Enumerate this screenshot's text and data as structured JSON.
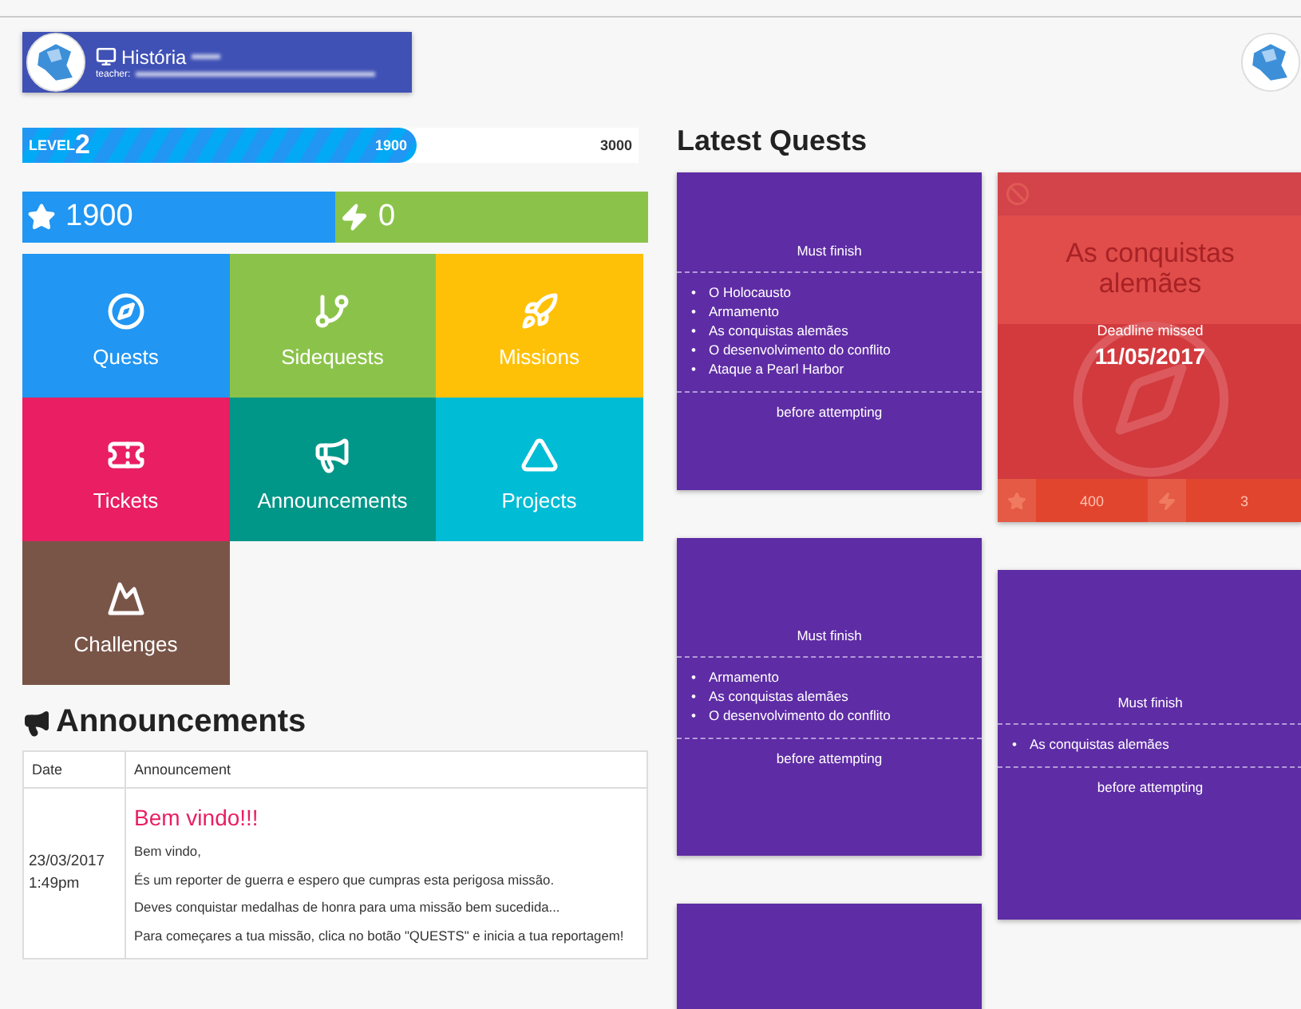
{
  "header": {
    "course_title": "História",
    "teacher_label": "teacher:"
  },
  "level_bar": {
    "label": "LEVEL",
    "number": "2",
    "current": "1900",
    "max": "3000",
    "level": 0.64
  },
  "stats": [
    {
      "kind": "xp",
      "value": "1900"
    },
    {
      "kind": "coins",
      "value": "0"
    }
  ],
  "menu_tiles": [
    {
      "label": "Quests",
      "color": "#2196f3"
    },
    {
      "label": "Sidequests",
      "color": "#8bc34a"
    },
    {
      "label": "Missions",
      "color": "#ffc107"
    },
    {
      "label": "Tickets",
      "color": "#e91e63"
    },
    {
      "label": "Announcements",
      "color": "#009688"
    },
    {
      "label": "Projects",
      "color": "#00bcd4"
    },
    {
      "label": "Challenges",
      "color": "#795548"
    }
  ],
  "announcements": {
    "heading": "Announcements",
    "columns": [
      "Date",
      "Announcement"
    ],
    "rows": [
      {
        "date": "23/03/2017",
        "time": "1:49pm",
        "title": "Bem vindo!!!",
        "paragraphs": [
          "Bem vindo,",
          "És um reporter de guerra e espero que cumpras esta perigosa missão.",
          "Deves conquistar medalhas de honra para uma missão bem sucedida...",
          "Para começares a tua missão, clica no botão \"QUESTS\" e inicia a tua reportagem!"
        ]
      }
    ]
  },
  "latest_quests": {
    "heading": "Latest Quests",
    "columns": [
      [
        {
          "kind": "locked",
          "header": "Must finish",
          "marker": "•",
          "items": [
            "O Holocausto",
            "Armamento",
            "As conquistas alemães",
            "O desenvolvimento do conflito",
            "Ataque a Pearl Harbor"
          ],
          "footer": "before attempting"
        },
        {
          "kind": "locked",
          "header": "Must finish",
          "marker": "•",
          "items": [
            "Armamento",
            "As conquistas alemães",
            "O desenvolvimento do conflito"
          ],
          "footer": "before attempting"
        },
        {
          "kind": "blank"
        }
      ],
      [
        {
          "kind": "missed",
          "title": "As conquistas alemães",
          "status": "Deadline missed",
          "date": "11/05/2017",
          "xp": "400",
          "coins": "3"
        },
        {
          "kind": "locked",
          "header": "Must finish",
          "marker": "•",
          "items": [
            "As conquistas alemães"
          ],
          "footer": "before attempting"
        }
      ]
    ]
  }
}
